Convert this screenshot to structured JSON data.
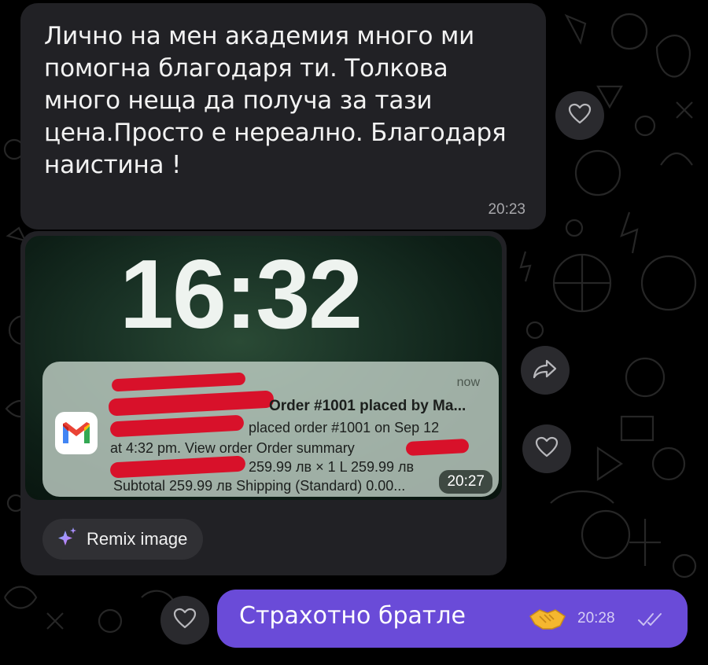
{
  "messages": {
    "first": {
      "text": "Лично на мен академия много ми помогна благодаря ти. Толкова много неща да получа за тази цена.Просто е нереално. Благодаря наистина !",
      "time": "20:23"
    },
    "screenshot": {
      "lock_time": "16:32",
      "notification": {
        "age": "now",
        "title": "Order #1001 placed by Ma...",
        "line2": "placed order #1001 on Sep 12",
        "line3": "at 4:32 pm. View order Order summary",
        "line4": "259.99 лв × 1 L 259.99 лв",
        "line5": "Subtotal 259.99 лв Shipping (Standard) 0.00..."
      },
      "time": "20:27",
      "remix_label": "Remix image"
    },
    "reply": {
      "text": "Страхотно братле",
      "time": "20:28"
    }
  },
  "colors": {
    "incoming_bubble": "#212125",
    "outgoing_bubble": "#6a4bd8",
    "redaction": "#d8112a"
  },
  "icons": [
    "heart-icon",
    "share-icon",
    "gmail-icon",
    "sparkle-icon",
    "handshake-emoji",
    "double-check-icon"
  ]
}
